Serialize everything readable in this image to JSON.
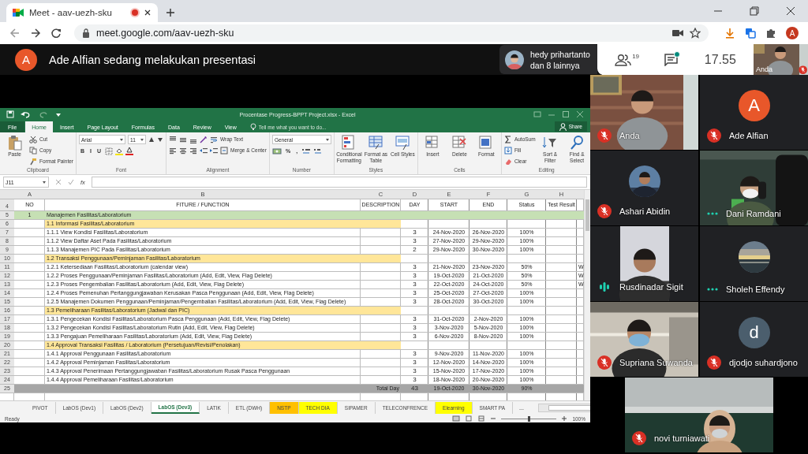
{
  "browser": {
    "tab_title": "Meet - aav-uezh-sku",
    "recording": true,
    "url": "meet.google.com/aav-uezh-sku",
    "profile_initial": "A"
  },
  "meeting": {
    "presenter_initial": "A",
    "presenter_text": "Ade Alfian sedang melakukan presentasi",
    "guest_name": "hedy prihartanto",
    "guest_others": "dan 8 lainnya",
    "people_count": "19",
    "chat_unread": true,
    "time": "17.55",
    "self_view": {
      "name": "Anda",
      "muted": true
    }
  },
  "excel": {
    "title": "Procentase Progress-BPPT Project.xlsx - Excel",
    "ribbon_tabs": [
      {
        "label": "File",
        "kind": "file",
        "selected": false
      },
      {
        "label": "Home",
        "kind": "tab",
        "selected": true
      },
      {
        "label": "Insert",
        "kind": "tab",
        "selected": false
      },
      {
        "label": "Page Layout",
        "kind": "tab",
        "selected": false
      },
      {
        "label": "Formulas",
        "kind": "tab",
        "selected": false
      },
      {
        "label": "Data",
        "kind": "tab",
        "selected": false
      },
      {
        "label": "Review",
        "kind": "tab",
        "selected": false
      },
      {
        "label": "View",
        "kind": "tab",
        "selected": false
      }
    ],
    "tell_me": "Tell me what you want to do...",
    "share": "Share",
    "ribbon_groups": [
      {
        "label": "Clipboard",
        "items": [
          {
            "kind": "large",
            "label": "Paste"
          },
          {
            "kind": "stack",
            "lines": [
              [
                {
                  "kind": "small",
                  "label": "Cut"
                }
              ],
              [
                {
                  "kind": "small",
                  "label": "Copy"
                }
              ],
              [
                {
                  "kind": "small",
                  "label": "Format Painter"
                }
              ]
            ]
          }
        ]
      },
      {
        "label": "Font",
        "items": [
          {
            "kind": "stack",
            "lines": [
              [
                {
                  "kind": "combo",
                  "value": "Arial"
                },
                {
                  "kind": "combo",
                  "value": "11"
                },
                {
                  "kind": "icon"
                },
                {
                  "kind": "icon"
                }
              ],
              [
                {
                  "kind": "toggle",
                  "label": "B"
                },
                {
                  "kind": "toggle",
                  "label": "I"
                },
                {
                  "kind": "toggle",
                  "label": "U"
                },
                {
                  "kind": "icon"
                },
                {
                  "kind": "icon"
                },
                {
                  "kind": "icon"
                }
              ]
            ]
          }
        ]
      },
      {
        "label": "Alignment",
        "items": [
          {
            "kind": "stack",
            "lines": [
              [
                {
                  "kind": "icon"
                },
                {
                  "kind": "icon"
                },
                {
                  "kind": "icon"
                },
                {
                  "kind": "icon"
                },
                {
                  "kind": "small",
                  "label": "Wrap Text"
                }
              ],
              [
                {
                  "kind": "icon"
                },
                {
                  "kind": "icon"
                },
                {
                  "kind": "icon"
                },
                {
                  "kind": "icon"
                },
                {
                  "kind": "icon"
                },
                {
                  "kind": "small",
                  "label": "Merge & Center"
                }
              ]
            ]
          }
        ]
      },
      {
        "label": "Number",
        "items": [
          {
            "kind": "stack",
            "lines": [
              [
                {
                  "kind": "combo",
                  "value": "General"
                }
              ],
              [
                {
                  "kind": "icon"
                },
                {
                  "kind": "toggle",
                  "label": "%"
                },
                {
                  "kind": "toggle",
                  "label": ","
                },
                {
                  "kind": "icon"
                },
                {
                  "kind": "icon"
                }
              ]
            ]
          }
        ]
      },
      {
        "label": "Styles",
        "items": [
          {
            "kind": "large",
            "label": "Conditional Formatting"
          },
          {
            "kind": "large",
            "label": "Format as Table"
          },
          {
            "kind": "large",
            "label": "Cell Styles"
          }
        ]
      },
      {
        "label": "Cells",
        "items": [
          {
            "kind": "large",
            "label": "Insert"
          },
          {
            "kind": "large",
            "label": "Delete"
          },
          {
            "kind": "large",
            "label": "Format"
          }
        ]
      },
      {
        "label": "Editing",
        "items": [
          {
            "kind": "stack",
            "lines": [
              [
                {
                  "kind": "small",
                  "label": "AutoSum"
                }
              ],
              [
                {
                  "kind": "small",
                  "label": "Fill"
                }
              ],
              [
                {
                  "kind": "small",
                  "label": "Clear"
                }
              ]
            ]
          },
          {
            "kind": "large",
            "label": "Sort & Filter"
          },
          {
            "kind": "large",
            "label": "Find & Select"
          }
        ]
      }
    ],
    "name_box": "J11",
    "function_label": "fx",
    "columns": [
      "A",
      "B",
      "C",
      "D",
      "E",
      "F",
      "G",
      "H"
    ],
    "header_row": {
      "row": "4",
      "cells": [
        "NO",
        "FITURE / FUNCTION",
        "DESCRIPTION",
        "DAY",
        "START",
        "END",
        "Status",
        "Test Result"
      ]
    },
    "rows": [
      {
        "row": "5",
        "kind": "group",
        "no": "1",
        "function": "Manajemen Fasilitas/Laboratorium"
      },
      {
        "row": "6",
        "kind": "section",
        "function": "1.1 Informasi Fasilitas/Laboratorium"
      },
      {
        "row": "7",
        "kind": "item",
        "function": "1.1.1 View  Kondisi Fasilitas/Laboratorium",
        "day": "3",
        "start": "24-Nov-2020",
        "end": "26-Nov-2020",
        "status": "100%"
      },
      {
        "row": "8",
        "kind": "item",
        "function": "1.1.2 View  Daftar Aset Pada Fasilitas/Laboratorium",
        "day": "3",
        "start": "27-Nov-2020",
        "end": "29-Nov-2020",
        "status": "100%"
      },
      {
        "row": "9",
        "kind": "item",
        "function": "1.1.3 Manajemen PIC Pada Fasilitas/Laboratorium",
        "day": "2",
        "start": "29-Nov-2020",
        "end": "30-Nov-2020",
        "status": "100%"
      },
      {
        "row": "10",
        "kind": "section",
        "function": "1.2 Transaksi Penggunaan/Peminjaman Fasilitas/Laboratorium"
      },
      {
        "row": "11",
        "kind": "item",
        "function": "1.2.1 Ketersediaan Fasilitas/Laboratorium (calendar view)",
        "day": "3",
        "start": "21-Nov-2020",
        "end": "23-Nov-2020",
        "status": "50%",
        "column_9": "W"
      },
      {
        "row": "12",
        "kind": "item",
        "function": "1.2.2 Proses Penggunaan/Peminjaman Fasilitas/Laboratorium (Add, Edit, View, Flag Delete)",
        "day": "3",
        "start": "19-Oct-2020",
        "end": "21-Oct-2020",
        "status": "50%",
        "column_9": "W"
      },
      {
        "row": "13",
        "kind": "item",
        "function": "1.2.3 Proses Pengembalian Fasilitas/Laboratorium (Add, Edit, View, Flag Delete)",
        "day": "3",
        "start": "22-Oct-2020",
        "end": "24-Oct-2020",
        "status": "50%",
        "column_9": "W"
      },
      {
        "row": "14",
        "kind": "item",
        "function": "1.2.4 Proses Pemenuhan Pertanggungjawaban Kerusakan Pasca Penggunaan (Add, Edit, View, Flag Delete)",
        "day": "3",
        "start": "25-Oct-2020",
        "end": "27-Oct-2020",
        "status": "100%"
      },
      {
        "row": "15",
        "kind": "item",
        "function": "1.2.5 Manajemen Dokumen Penggunaan/Peminjaman/Pengembalian Fasilitas/Laboratorium (Add, Edit, View, Flag Delete)",
        "day": "3",
        "start": "28-Oct-2020",
        "end": "30-Oct-2020",
        "status": "100%"
      },
      {
        "row": "16",
        "kind": "section",
        "function": "1.3 Pemeliharaan Fasilitas/Laboratorium (Jadwal dan PIC)"
      },
      {
        "row": "17",
        "kind": "item",
        "function": "1.3.1 Pengecekan Kondisi Fasilitas/Laboratorium Pasca Penggunaan (Add, Edit, View, Flag Delete)",
        "day": "3",
        "start": "31-Oct-2020",
        "end": "2-Nov-2020",
        "status": "100%"
      },
      {
        "row": "18",
        "kind": "item",
        "function": "1.3.2 Pengecekan Kondisi Fasilitas/Laboratorium Rutin (Add, Edit, View, Flag Delete)",
        "day": "3",
        "start": "3-Nov-2020",
        "end": "5-Nov-2020",
        "status": "100%"
      },
      {
        "row": "19",
        "kind": "item",
        "function": "1.3.3 Pengajuan Pemeliharaan Fasilitas/Laboratorium (Add, Edit, View, Flag Delete)",
        "day": "3",
        "start": "6-Nov-2020",
        "end": "8-Nov-2020",
        "status": "100%"
      },
      {
        "row": "20",
        "kind": "section",
        "function": "1.4 Approval Transaksi Fasilitas / Laboratorium (Persetujuan/Revisi/Penolakan)"
      },
      {
        "row": "21",
        "kind": "item",
        "function": "1.4.1 Approval Penggunaan Fasilitas/Laboratorium",
        "day": "3",
        "start": "9-Nov-2020",
        "end": "11-Nov-2020",
        "status": "100%"
      },
      {
        "row": "22",
        "kind": "item",
        "function": "1.4.2 Approval Peminjaman Fasilitas/Laboratorium",
        "day": "3",
        "start": "12-Nov-2020",
        "end": "14-Nov-2020",
        "status": "100%"
      },
      {
        "row": "23",
        "kind": "item",
        "function": "1.4.3 Approval Penerimaan Pertanggungjawaban Fasilitas/Laboratorium Rusak Pasca Penggunaan",
        "day": "3",
        "start": "15-Nov-2020",
        "end": "17-Nov-2020",
        "status": "100%"
      },
      {
        "row": "24",
        "kind": "item",
        "function": "1.4.4 Approval Pemeliharaan Fasilitas/Laboratorium",
        "day": "3",
        "start": "18-Nov-2020",
        "end": "20-Nov-2020",
        "status": "100%"
      },
      {
        "row": "25",
        "kind": "total",
        "description": "Total Day",
        "day": "43",
        "start": "19-Oct-2020",
        "end": "30-Nov-2020",
        "status": "90%"
      }
    ],
    "sheet_tabs": [
      {
        "label": "PIVOT",
        "selected": false
      },
      {
        "label": "LabOS (Dev1)",
        "selected": false
      },
      {
        "label": "LabOS (Dev2)",
        "selected": false
      },
      {
        "label": "LabOS (Dev3)",
        "selected": true
      },
      {
        "label": "LATIK",
        "selected": false
      },
      {
        "label": "ETL (DWH)",
        "selected": false
      },
      {
        "label": "NSTP",
        "selected": false,
        "color": "#ffc000"
      },
      {
        "label": "TECH DIA",
        "selected": false,
        "color": "#ffff00"
      },
      {
        "label": "SIPAMER",
        "selected": false
      },
      {
        "label": "TELECONFRENCE",
        "selected": false
      },
      {
        "label": "Elearning",
        "selected": false,
        "color": "#ffff00"
      },
      {
        "label": "SMART PA",
        "selected": false
      }
    ],
    "more_tabs": "...",
    "status": "Ready",
    "zoom": {
      "label": "100%",
      "level": 0.5
    }
  },
  "participants": [
    {
      "name": "Anda",
      "muted": true,
      "speaking": false,
      "kind": "video"
    },
    {
      "name": "Ade Alfian",
      "muted": true,
      "speaking": false,
      "kind": "letter",
      "letter": "A",
      "color": "#e8572a"
    },
    {
      "name": "Ashari Abidin",
      "muted": true,
      "speaking": false
    },
    {
      "name": "Dani Ramdani",
      "muted": false,
      "speaking": false,
      "kind": "video"
    },
    {
      "name": "Rusdinadar Sigit",
      "muted": false,
      "speaking": true,
      "kind": "video"
    },
    {
      "name": "Sholeh Effendy",
      "muted": false,
      "speaking": false
    },
    {
      "name": "Supriana Suwanda",
      "muted": true,
      "speaking": false,
      "kind": "video"
    },
    {
      "name": "djodjo suhardjono",
      "muted": true,
      "speaking": false,
      "kind": "letter",
      "letter": "d",
      "color": "#4b5e6d"
    },
    {
      "name": "novi turniawati",
      "muted": true,
      "speaking": false,
      "kind": "video"
    }
  ]
}
